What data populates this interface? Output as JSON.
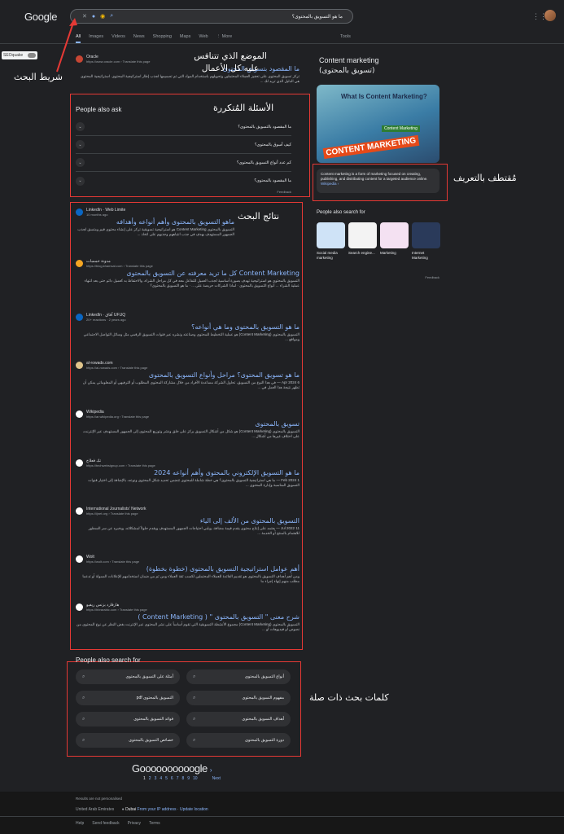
{
  "header": {
    "logo": "Google",
    "query": "ما هو التسويق بالمحتوى؟",
    "clear_icon": "close-icon",
    "tabs": [
      "All",
      "Images",
      "Videos",
      "News",
      "Shopping",
      "Maps",
      "Web",
      "⋮ More"
    ],
    "tools": "Tools"
  },
  "seoquake": "SEOquake",
  "annotations": {
    "search_bar": "شريط البحث",
    "position": "الموضع الذي تتنافس عليه كل الأعمال",
    "faq": "الأسئلة المُتكررة",
    "results": "نتائج البحث",
    "snippet": "مُقتطف بالتعريف",
    "related": "كلمات بحث ذات صلة"
  },
  "top_result": {
    "site": "Oracle",
    "url": "https://www.oracle.com › Translate this page",
    "title": "ما المقصود بتسويق المحتوى",
    "snippet": "تركز تسويق المحتوى على تحفيز العملاء المحتملين وتحويلهم باستخدام المواد التي تم تصميمها لجذب إطار استراتيجية المحتوى. استراتيجية المحتوى هي الدليل الذي تريد لك ..."
  },
  "paa": {
    "title": "People also ask",
    "questions": [
      "ما المقصود بالتسويق بالمحتوى؟",
      "كيف أسوق بالمحتوى؟",
      "كم عدد أنواع التسويق بالمحتوى؟",
      "ما المقصود بالمحتوى؟"
    ],
    "feedback": "Feedback"
  },
  "results": [
    {
      "site": "LinkedIn · Web Limite",
      "url": "10 months ago",
      "title": "ماهو التسويق بالمحتوى وأهم أنواعه وأهدافه",
      "snippet": "التسويق بالمحتوى Content Marketing هو استراتيجية تسويقية تركز على إنشاء محتوى قيم ومتسق لجذب الجمهور المستهدف بهدف في جذب انتباههم وجذبهم على اتخاذ ..."
    },
    {
      "site": "مدونة خمسات",
      "url": "https://blog.khamsat.com › Translate this page",
      "title": "Content Marketing كل ما تريد معرفته عن التسويق بالمحتوى",
      "snippet": "التسويق بالمحتوى هو استراتيجية تهدف بصورة أساسية لجذب العميل للتفاعل معه في كل مراحل الشراء، والاحتفاظ به كعميل دائم حتى بعد انتهاء عملية الشراء ... أنواع التسويق بالمحتوى · لماذا الشركات حريصة على ... · ما هو التسويق بالمحتوى؟"
    },
    {
      "site": "LinkedIn · آفاق UFUQ",
      "url": "20+ reactions · 2 years ago",
      "title": "ما هو التسويق بالمحتوى وما هي أنواعه؟",
      "snippet": "التسويق بالمحتوى (Content Marketing) هو عملية التخطيط للمحتوى وصناعته ونشره عبر قنوات التسويق الرقمي مثل وسائل التواصل الاجتماعي ومواقع ..."
    },
    {
      "site": "al-rowads.com",
      "url": "https://al-rowads.com › Translate this page",
      "title": "ما هو تسويق المحتوى؟ مراحل وأنواع التسويق بالمحتوى",
      "snippet": "6 Apr 2024 — في هذا النوع من التسويق، تحاول الشركة مساعدة الأفراد من خلال مشاركة المحتوى المطلوب أو الترفيهي أو المعلوماتي يمكن أن تظهر نتيجة هذا العمل في ..."
    },
    {
      "site": "Wikipedia",
      "url": "https://ar.wikipedia.org › Translate this page",
      "title": "تسويق بالمحتوى",
      "snippet": "التسويق بالمحتوى (Content Marketing) هو شكل من أشكال التسويق يركز على خلق ونشر وتوزيع المحتوى إلى الجمهور المستهدف عبر الإنترنت، على اختلاف غيرها من أشكال ..."
    },
    {
      "site": "تك فعلاج",
      "url": "https://techwebsignup.com › Translate this page",
      "title": "ما هو التسويق الإلكتروني بالمحتوى وأهم أنواعه 2024",
      "snippet": "1 Feb 2024 — ما هي استراتيجية التسويق بالمحتوى؟ هي خطة شاملة للمحتوى تتضمن تحديد شكل المحتوى ونوعه، بالإضافة إلى اختيار قنوات التسويق المناسبة وإدارة المحتوى ..."
    },
    {
      "site": "International Journalists' Network",
      "url": "https://ijnet.org › Translate this page",
      "title": "التسويق بالمحتوى من الألف إلى الياء",
      "snippet": "11 Jul 2022 — يعتمد على إنتاج محتوى يقدم قيمة مضافة، ويلبي احتياجات الجمهور المستهدف ويقدم حلولاً لمشكلاته، ويخبره عن سر السطور للاهتمام بالمنتج أو الخدمة ..."
    },
    {
      "site": "Wolt",
      "url": "https://wolt.com › Translate this page",
      "title": "أهم عوامل استراتيجية التسويق بالمحتوى (خطوة بخطوة)",
      "snippet": "ومن أهم أهداف التسويق بالمحتوى هو تقديم الفائدة للعملاء المحتملين لكسب ثقة العملاء ومن ثم من ضمان استخدامهم للإعلانات الممولة أو تدعما مطلب منهم إنهاء إجراء ما"
    },
    {
      "site": "هارفارد بزنس ريفيو",
      "url": "https://hbrarabic.com › Translate this page",
      "title": "شرح معنى \" التسويق بالمحتوى \" ( Content Marketing )",
      "snippet": "التسويق بالمحتوى (Content Marketing) مجموع الأنشطة التسويقية التي تقوم أساساً على نشر المحتوى عبر الإنترنت بغض النظر عن نوع المحتوى من نصوص أو فيديوهات أو ..."
    }
  ],
  "knowledge_panel": {
    "title": "Content marketing",
    "subtitle": "(تسويق بالمحتوى)",
    "image_heading": "What Is Content Marketing?",
    "image_badge": "Content Marketing",
    "image_badge2": "CONTENT MARKETING",
    "definition": "Content marketing is a form of marketing focused on creating, publishing, and distributing content for a targeted audience online.",
    "source": "Wikipedia ›",
    "pas_title": "People also search for",
    "pas_items": [
      "Social media marketing",
      "Search engine...",
      "Marketing",
      "Internet Marketing"
    ],
    "feedback": "Feedback"
  },
  "related": {
    "title": "People also search for",
    "items": [
      "أمثلة على التسويق بالمحتوى",
      "أنواع التسويق بالمحتوى",
      "التسويق بالمحتوى pdf",
      "مفهوم التسويق بالمحتوى",
      "فوائد التسويق بالمحتوى",
      "أهداف التسويق بالمحتوى",
      "خصائص التسويق بالمحتوى",
      "دورة التسويق بالمحتوى"
    ]
  },
  "pagination": {
    "logo": "Goooooooooogle",
    "pages": [
      "1",
      "2",
      "3",
      "4",
      "5",
      "6",
      "7",
      "8",
      "9",
      "10"
    ],
    "next": "Next"
  },
  "footer": {
    "notice": "Results are not personalised",
    "country": "United Arab Emirates",
    "city": "Dubai",
    "loc_links": "From your IP address · Update location",
    "links": [
      "Help",
      "Send feedback",
      "Privacy",
      "Terms"
    ]
  }
}
